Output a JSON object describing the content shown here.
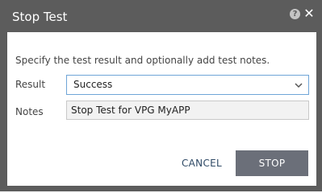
{
  "dialog": {
    "title": "Stop Test",
    "help_glyph": "?",
    "close_glyph": "✕",
    "instruction": "Specify the test result and optionally add test notes.",
    "result": {
      "label": "Result",
      "selected": "Success"
    },
    "notes": {
      "label": "Notes",
      "value": "Stop Test for VPG MyAPP"
    },
    "buttons": {
      "cancel": "CANCEL",
      "stop": "STOP"
    }
  },
  "colors": {
    "titlebar": "#5c5c5c",
    "stop_button": "#6b6f79",
    "cancel_text": "#2f4a66",
    "select_border": "#6fa5d7",
    "notes_bg": "#f2f2f2"
  },
  "icons": {
    "help": "help-icon",
    "close": "close-icon",
    "dropdown": "chevron-down-icon"
  }
}
